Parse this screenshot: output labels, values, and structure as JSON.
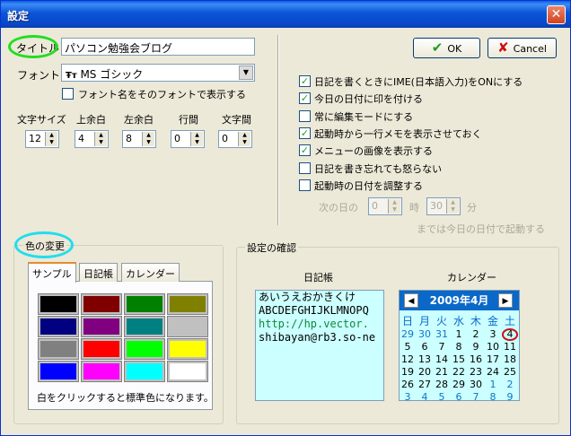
{
  "window": {
    "title": "設定"
  },
  "title_field": {
    "label": "タイトル",
    "value": "パソコン勉強会ブログ"
  },
  "font": {
    "label": "フォント",
    "value": "MS ゴシック",
    "show_font_name_label": "フォント名をそのフォントで表示する",
    "show_font_name_checked": false
  },
  "spinners": [
    {
      "label": "文字サイズ",
      "value": "12"
    },
    {
      "label": "上余白",
      "value": "4"
    },
    {
      "label": "左余白",
      "value": "8"
    },
    {
      "label": "行間",
      "value": "0"
    },
    {
      "label": "文字間",
      "value": "0"
    }
  ],
  "buttons": {
    "ok": "OK",
    "cancel": "Cancel"
  },
  "options": [
    {
      "label": "日記を書くときにIME(日本語入力)をONにする",
      "checked": true
    },
    {
      "label": "今日の日付に印を付ける",
      "checked": true
    },
    {
      "label": "常に編集モードにする",
      "checked": false
    },
    {
      "label": "起動時から一行メモを表示させておく",
      "checked": true
    },
    {
      "label": "メニューの画像を表示する",
      "checked": true
    },
    {
      "label": "日記を書き忘れても怒らない",
      "checked": false
    },
    {
      "label": "起動時の日付を調整する",
      "checked": false
    }
  ],
  "date_adjust": {
    "prefix": "次の日の",
    "hour": "0",
    "hour_unit": "時",
    "minute": "30",
    "minute_unit": "分",
    "note": "までは今日の日付で起動する"
  },
  "color_group": {
    "title": "色の変更",
    "tabs": [
      "サンプル",
      "日記帳",
      "カレンダー"
    ],
    "swatches": [
      "#000000",
      "#800000",
      "#008000",
      "#808000",
      "#000080",
      "#800080",
      "#008080",
      "#c0c0c0",
      "#808080",
      "#ff0000",
      "#00ff00",
      "#ffff00",
      "#0000ff",
      "#ff00ff",
      "#00ffff",
      "#ffffff"
    ],
    "hint": "白をクリックすると標準色になります。"
  },
  "confirm_group": {
    "title": "設定の確認",
    "diary_label": "日記帳",
    "calendar_label": "カレンダー",
    "preview_lines": [
      "あいうえおかきくけ",
      "ABCDEFGHIJKLMNOPQ",
      "http://hp.vector.",
      "shibayan@rb3.so-ne"
    ],
    "calendar_month": "2009年4月",
    "weekdays": [
      "日",
      "月",
      "火",
      "水",
      "木",
      "金",
      "土"
    ],
    "days": [
      [
        "29",
        "30",
        "31",
        "1",
        "2",
        "3",
        "4"
      ],
      [
        "5",
        "6",
        "7",
        "8",
        "9",
        "10",
        "11"
      ],
      [
        "12",
        "13",
        "14",
        "15",
        "16",
        "17",
        "18"
      ],
      [
        "19",
        "20",
        "21",
        "22",
        "23",
        "24",
        "25"
      ],
      [
        "26",
        "27",
        "28",
        "29",
        "30",
        "1",
        "2"
      ],
      [
        "3",
        "4",
        "5",
        "6",
        "7",
        "8",
        "9"
      ]
    ],
    "nav_prev": "◀",
    "nav_next": "▶"
  },
  "annotation_colors": {
    "title_circle": "#22dd22",
    "color_circle": "#22ddee"
  }
}
